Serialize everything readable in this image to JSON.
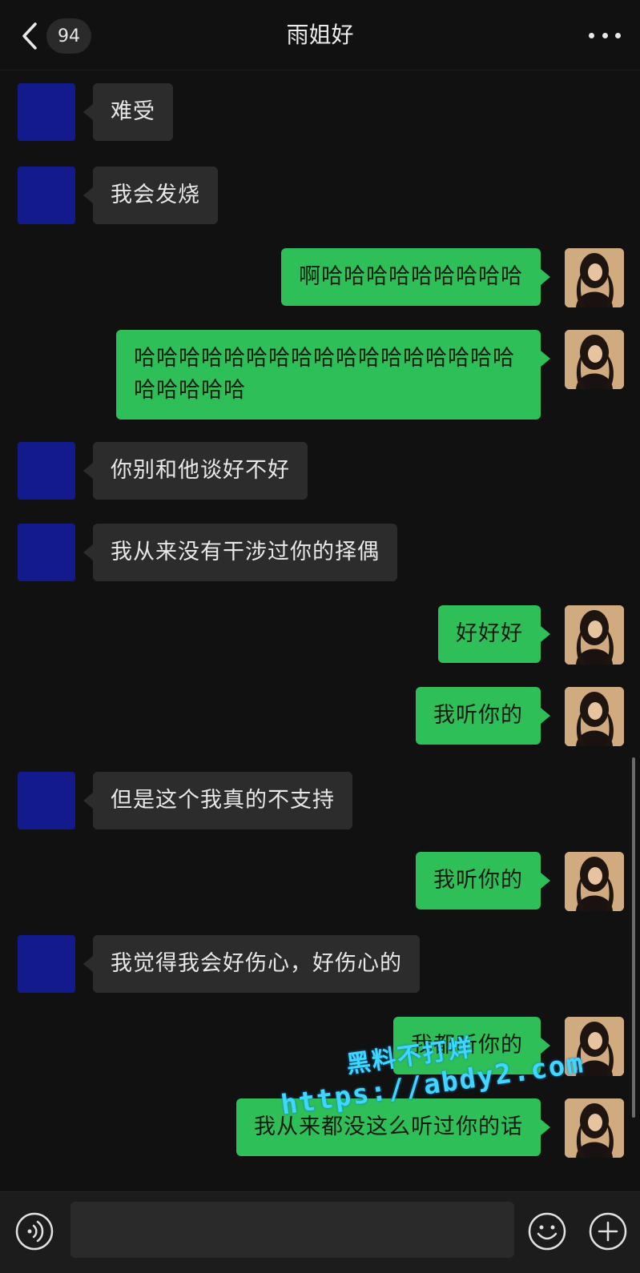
{
  "header": {
    "back_icon": "chevron-left-icon",
    "unread_count": "94",
    "title": "雨姐好",
    "more_icon": "ellipsis-icon"
  },
  "colors": {
    "background": "#111111",
    "incoming_bubble": "#2c2c2c",
    "outgoing_bubble": "#2fbf59",
    "contact_avatar": "#121a8c"
  },
  "messages": [
    {
      "side": "left",
      "text": "难受"
    },
    {
      "side": "left",
      "text": "我会发烧"
    },
    {
      "side": "right",
      "text": "啊哈哈哈哈哈哈哈哈哈"
    },
    {
      "side": "right",
      "text": "哈哈哈哈哈哈哈哈哈哈哈哈哈哈哈哈哈哈哈哈哈哈"
    },
    {
      "side": "left",
      "text": "你别和他谈好不好"
    },
    {
      "side": "left",
      "text": "我从来没有干涉过你的择偶"
    },
    {
      "side": "right",
      "text": "好好好"
    },
    {
      "side": "right",
      "text": "我听你的"
    },
    {
      "side": "left",
      "text": "但是这个我真的不支持"
    },
    {
      "side": "right",
      "text": "我听你的"
    },
    {
      "side": "left",
      "text": "我觉得我会好伤心，好伤心的"
    },
    {
      "side": "right",
      "text": "我都听你的"
    },
    {
      "side": "right",
      "text": "我从来都没这么听过你的话"
    }
  ],
  "watermark": {
    "line1": "黑料不打烊",
    "line2": "https://abdy2.com"
  },
  "input_bar": {
    "voice_icon": "voice-icon",
    "input_value": "",
    "emoji_icon": "emoji-icon",
    "plus_icon": "plus-icon"
  }
}
